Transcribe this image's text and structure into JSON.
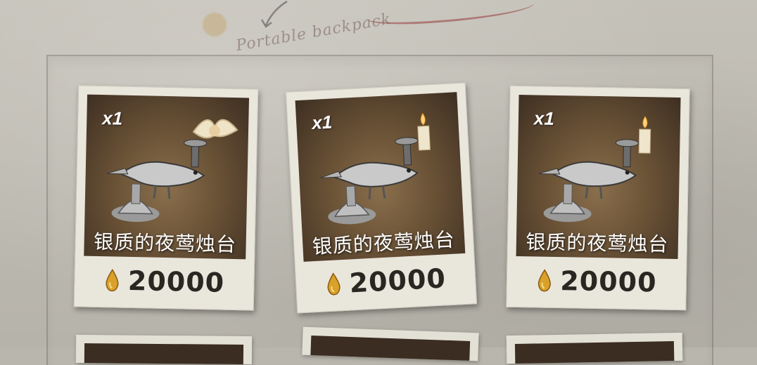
{
  "backpack_label": "Portable backpack",
  "colors": {
    "accent_oil": "#d9a12a",
    "art_bg": "#6a5236",
    "card_paper": "#e9e6dc"
  },
  "items": [
    {
      "qty": "x1",
      "name": "银质的夜莺烛台",
      "price": "20000",
      "icon": "nightingale-candlestick-icon",
      "topper": "winged-ornament-icon"
    },
    {
      "qty": "x1",
      "name": "银质的夜莺烛台",
      "price": "20000",
      "icon": "nightingale-candlestick-icon",
      "topper": "candle-icon"
    },
    {
      "qty": "x1",
      "name": "银质的夜莺烛台",
      "price": "20000",
      "icon": "nightingale-candlestick-icon",
      "topper": "candle-icon"
    }
  ]
}
